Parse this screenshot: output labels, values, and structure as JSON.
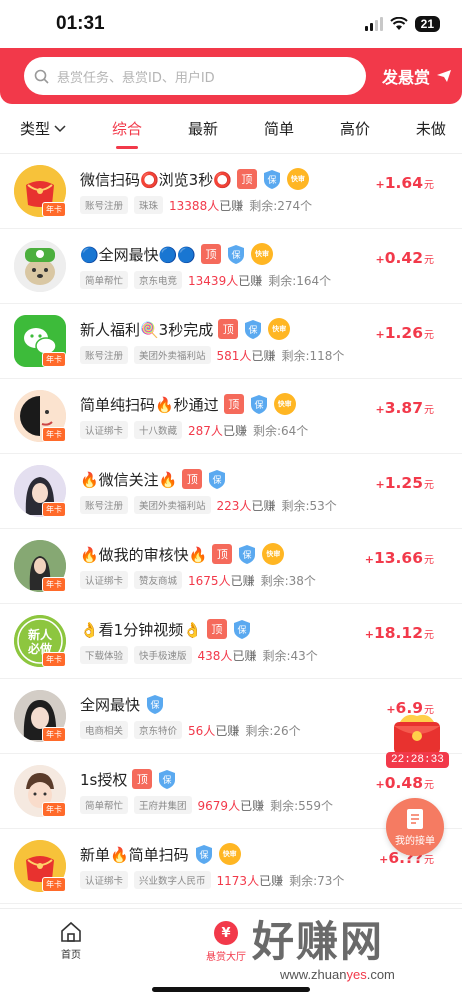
{
  "status": {
    "time": "01:31",
    "battery": "21"
  },
  "header": {
    "search_placeholder": "悬赏任务、悬赏ID、用户ID",
    "post_label": "发悬赏"
  },
  "filters": [
    {
      "label": "类型"
    },
    {
      "label": "综合"
    },
    {
      "label": "最新"
    },
    {
      "label": "简单"
    },
    {
      "label": "高价"
    },
    {
      "label": "未做"
    }
  ],
  "tasks": [
    {
      "title": "微信扫码⭕浏览3秒⭕",
      "top": "顶",
      "fast": "快审",
      "year": "年卡",
      "chip1": "账号注册",
      "chip2": "珠珠",
      "earned": "13388人",
      "earned_suffix": "已赚",
      "remain": "剩余:274个",
      "plus": "+",
      "price": "1.64",
      "unit": "元"
    },
    {
      "title": "🔵全网最快🔵🔵",
      "top": "顶",
      "fast": "快审",
      "year": "",
      "chip1": "简单帮忙",
      "chip2": "京东电竞",
      "earned": "13439人",
      "earned_suffix": "已赚",
      "remain": "剩余:164个",
      "plus": "+",
      "price": "0.42",
      "unit": "元"
    },
    {
      "title": "新人福利🍭3秒完成",
      "top": "顶",
      "fast": "快审",
      "year": "年卡",
      "chip1": "账号注册",
      "chip2": "美团外卖福利站",
      "earned": "581人",
      "earned_suffix": "已赚",
      "remain": "剩余:118个",
      "plus": "+",
      "price": "1.26",
      "unit": "元"
    },
    {
      "title": "简单纯扫码🔥秒通过",
      "top": "顶",
      "fast": "快审",
      "year": "年卡",
      "chip1": "认证绑卡",
      "chip2": "十八数藏",
      "earned": "287人",
      "earned_suffix": "已赚",
      "remain": "剩余:64个",
      "plus": "+",
      "price": "3.87",
      "unit": "元"
    },
    {
      "title": "🔥微信关注🔥",
      "top": "顶",
      "fast": "",
      "year": "年卡",
      "chip1": "账号注册",
      "chip2": "美团外卖福利站",
      "earned": "223人",
      "earned_suffix": "已赚",
      "remain": "剩余:53个",
      "plus": "+",
      "price": "1.25",
      "unit": "元"
    },
    {
      "title": "🔥做我的审核快🔥",
      "top": "顶",
      "fast": "快审",
      "year": "年卡",
      "chip1": "认证绑卡",
      "chip2": "赞友商城",
      "earned": "1675人",
      "earned_suffix": "已赚",
      "remain": "剩余:38个",
      "plus": "+",
      "price": "13.66",
      "unit": "元"
    },
    {
      "title": "👌看1分钟视频👌",
      "top": "顶",
      "fast": "",
      "year": "年卡",
      "chip1": "下载体验",
      "chip2": "快手极速版",
      "earned": "438人",
      "earned_suffix": "已赚",
      "remain": "剩余:43个",
      "plus": "+",
      "price": "18.12",
      "unit": "元"
    },
    {
      "title": "全网最快",
      "top": "",
      "fast": "",
      "year": "年卡",
      "chip1": "电商相关",
      "chip2": "京东特价",
      "earned": "56人",
      "earned_suffix": "已赚",
      "remain": "剩余:26个",
      "plus": "+",
      "price": "6.9",
      "unit": "元"
    },
    {
      "title": "1s授权",
      "top": "顶",
      "fast": "",
      "year": "年卡",
      "chip1": "简单帮忙",
      "chip2": "王府井集团",
      "earned": "9679人",
      "earned_suffix": "已赚",
      "remain": "剩余:559个",
      "plus": "+",
      "price": "0.48",
      "unit": "元"
    },
    {
      "title": "新单🔥简单扫码",
      "top": "",
      "fast": "快审",
      "year": "年卡",
      "chip1": "认证绑卡",
      "chip2": "兴业数字人民币",
      "earned": "1173人",
      "earned_suffix": "已赚",
      "remain": "剩余:73个",
      "plus": "+",
      "price": "6.??",
      "unit": "元"
    }
  ],
  "floating": {
    "timer": "22:28:33",
    "orders_label": "我的接单"
  },
  "tabbar": {
    "home": "首页",
    "hall": "悬赏大厅",
    "hall_symbol": "¥"
  },
  "watermark": {
    "big": "好赚网",
    "url_a": "www.zhuan",
    "url_b": "yes",
    "url_c": ".com"
  },
  "colors": {
    "accent": "#f2394a",
    "top_tag": "#f56a5b",
    "fast_tag": "#ffb623",
    "bao_tag": "#5aa9f0"
  }
}
